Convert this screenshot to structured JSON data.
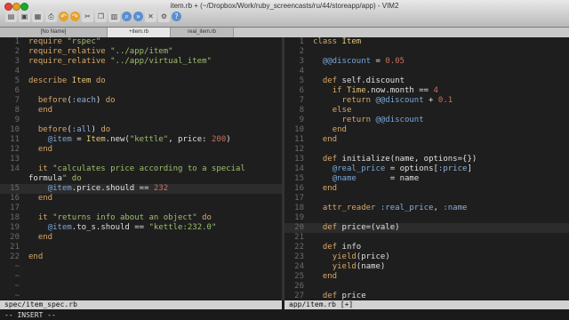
{
  "window": {
    "title": "item.rb + (~/Dropbox/Work/ruby_screencasts/ru/44/storeapp/app) - VIM2"
  },
  "toolbar": {
    "icons": [
      "open-icon",
      "save-icon",
      "save-all-icon",
      "print-icon",
      "undo-icon",
      "redo-icon",
      "cut-icon",
      "copy-icon",
      "paste-icon",
      "find-icon",
      "find-next-icon",
      "close-icon",
      "settings-icon",
      "help-icon"
    ]
  },
  "tabs": [
    {
      "label": "[No Name]"
    },
    {
      "label": "+item.rb"
    },
    {
      "label": "real_item.rb"
    }
  ],
  "left_pane": {
    "lines": [
      {
        "n": "1",
        "t": "require \"rspec\""
      },
      {
        "n": "2",
        "t": "require_relative \"../app/item\""
      },
      {
        "n": "3",
        "t": "require_relative \"../app/virtual_item\""
      },
      {
        "n": "4",
        "t": ""
      },
      {
        "n": "5",
        "t": "describe Item do"
      },
      {
        "n": "6",
        "t": ""
      },
      {
        "n": "7",
        "t": "  before(:each) do"
      },
      {
        "n": "8",
        "t": "  end"
      },
      {
        "n": "9",
        "t": ""
      },
      {
        "n": "10",
        "t": "  before(:all) do"
      },
      {
        "n": "11",
        "t": "    @item = Item.new(\"kettle\", price: 200)"
      },
      {
        "n": "12",
        "t": "  end"
      },
      {
        "n": "13",
        "t": ""
      },
      {
        "n": "14",
        "t": "  it \"calculates price according to a special"
      },
      {
        "n": "",
        "t": "formula\" do"
      },
      {
        "n": "15",
        "t": "    @item.price.should == 232"
      },
      {
        "n": "16",
        "t": "  end"
      },
      {
        "n": "17",
        "t": ""
      },
      {
        "n": "18",
        "t": "  it \"returns info about an object\" do"
      },
      {
        "n": "19",
        "t": "    @item.to_s.should == \"kettle:232.0\""
      },
      {
        "n": "20",
        "t": "  end"
      },
      {
        "n": "21",
        "t": ""
      },
      {
        "n": "22",
        "t": "end"
      },
      {
        "n": "~",
        "t": ""
      },
      {
        "n": "~",
        "t": ""
      },
      {
        "n": "~",
        "t": ""
      },
      {
        "n": "~",
        "t": ""
      }
    ],
    "status": "spec/item_spec.rb"
  },
  "right_pane": {
    "lines": [
      {
        "n": "1",
        "t": "class Item"
      },
      {
        "n": "2",
        "t": ""
      },
      {
        "n": "3",
        "t": "  @@discount = 0.05"
      },
      {
        "n": "4",
        "t": ""
      },
      {
        "n": "5",
        "t": "  def self.discount"
      },
      {
        "n": "6",
        "t": "    if Time.now.month == 4"
      },
      {
        "n": "7",
        "t": "      return @@discount + 0.1"
      },
      {
        "n": "8",
        "t": "    else"
      },
      {
        "n": "9",
        "t": "      return @@discount"
      },
      {
        "n": "10",
        "t": "    end"
      },
      {
        "n": "11",
        "t": "  end"
      },
      {
        "n": "12",
        "t": ""
      },
      {
        "n": "13",
        "t": "  def initialize(name, options={})"
      },
      {
        "n": "14",
        "t": "    @real_price = options[:price]"
      },
      {
        "n": "15",
        "t": "    @name       = name"
      },
      {
        "n": "16",
        "t": "  end"
      },
      {
        "n": "17",
        "t": ""
      },
      {
        "n": "18",
        "t": "  attr_reader :real_price, :name"
      },
      {
        "n": "19",
        "t": ""
      },
      {
        "n": "20",
        "t": "  def price=(vale)"
      },
      {
        "n": "21",
        "t": ""
      },
      {
        "n": "22",
        "t": "  def info"
      },
      {
        "n": "23",
        "t": "    yield(price)"
      },
      {
        "n": "24",
        "t": "    yield(name)"
      },
      {
        "n": "25",
        "t": "  end"
      },
      {
        "n": "26",
        "t": ""
      },
      {
        "n": "27",
        "t": "  def price"
      }
    ],
    "status": "app/item.rb  [+]"
  },
  "mode": "-- INSERT --",
  "colors": {
    "background": "#1e1e1e",
    "keyword": "#d8a766",
    "string": "#9fbe6f",
    "instance_var": "#7aa7d8",
    "number": "#c9705d"
  }
}
